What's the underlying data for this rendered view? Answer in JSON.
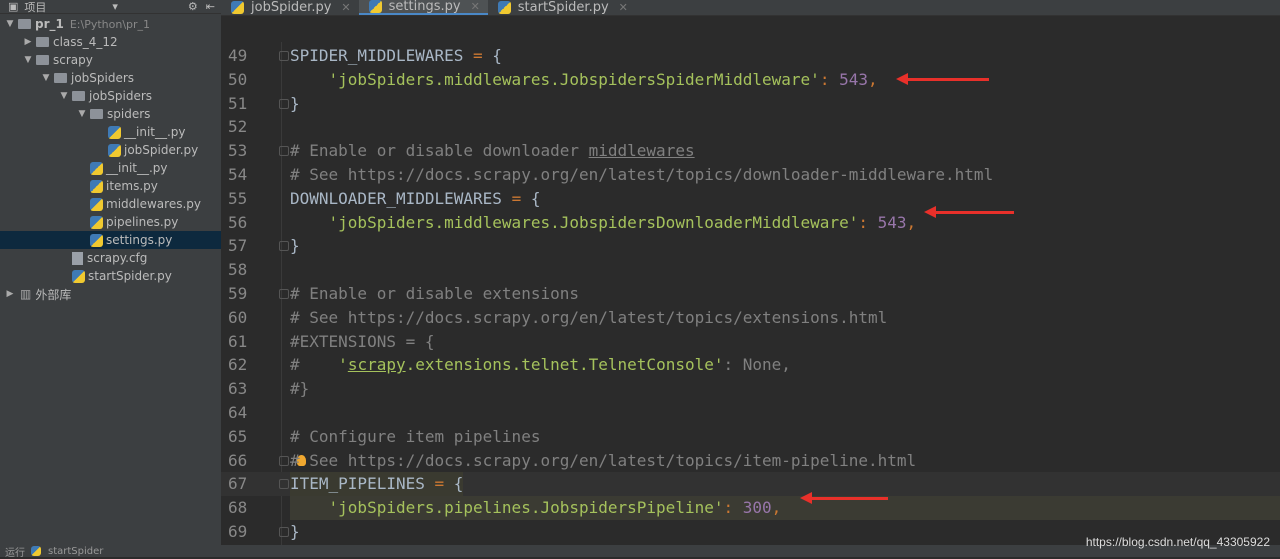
{
  "sidebar": {
    "title": "项目",
    "tree": [
      {
        "label": "pr_1",
        "path": "E:\\Python\\pr_1",
        "type": "folder",
        "depth": 0,
        "open": true
      },
      {
        "label": "class_4_12",
        "type": "folder",
        "depth": 1,
        "open": false
      },
      {
        "label": "scrapy",
        "type": "folder",
        "depth": 1,
        "open": true
      },
      {
        "label": "jobSpiders",
        "type": "folder",
        "depth": 2,
        "open": true
      },
      {
        "label": "jobSpiders",
        "type": "folder",
        "depth": 3,
        "open": true
      },
      {
        "label": "spiders",
        "type": "folder",
        "depth": 4,
        "open": true
      },
      {
        "label": "__init__.py",
        "type": "py",
        "depth": 5
      },
      {
        "label": "jobSpider.py",
        "type": "py",
        "depth": 5
      },
      {
        "label": "__init__.py",
        "type": "py",
        "depth": 4
      },
      {
        "label": "items.py",
        "type": "py",
        "depth": 4
      },
      {
        "label": "middlewares.py",
        "type": "py",
        "depth": 4
      },
      {
        "label": "pipelines.py",
        "type": "py",
        "depth": 4
      },
      {
        "label": "settings.py",
        "type": "py",
        "depth": 4,
        "selected": true
      },
      {
        "label": "scrapy.cfg",
        "type": "cfg",
        "depth": 3
      },
      {
        "label": "startSpider.py",
        "type": "py",
        "depth": 3
      },
      {
        "label": "外部库",
        "type": "lib",
        "depth": 0,
        "open": false
      }
    ]
  },
  "tabs": [
    {
      "label": "jobSpider.py"
    },
    {
      "label": "settings.py",
      "active": true
    },
    {
      "label": "startSpider.py"
    }
  ],
  "lines": [
    {
      "n": "49",
      "html": "SPIDER_MIDDLEWARES <span class='op'>=</span> {",
      "fold": true
    },
    {
      "n": "50",
      "html": "    <span class='st'>'jobSpiders.middlewares.JobspidersSpiderMiddleware'</span><span class='op'>:</span> <span class='nm'>543</span><span class='op'>,</span>"
    },
    {
      "n": "51",
      "html": "}",
      "fold": true
    },
    {
      "n": "52",
      "html": ""
    },
    {
      "n": "53",
      "html": "<span class='cm'># Enable or disable downloader <u>middlewares</u></span>",
      "fold": true
    },
    {
      "n": "54",
      "html": "<span class='cm'># See https://docs.scrapy.org/en/latest/topics/downloader-middleware.html</span>"
    },
    {
      "n": "55",
      "html": "DOWNLOADER_MIDDLEWARES <span class='op'>=</span> {"
    },
    {
      "n": "56",
      "html": "    <span class='st'>'jobSpiders.middlewares.JobspidersDownloaderMiddleware'</span><span class='op'>:</span> <span class='nm'>543</span><span class='op'>,</span>"
    },
    {
      "n": "57",
      "html": "}",
      "fold": true
    },
    {
      "n": "58",
      "html": ""
    },
    {
      "n": "59",
      "html": "<span class='cm'># Enable or disable extensions</span>",
      "fold": true
    },
    {
      "n": "60",
      "html": "<span class='cm'># See https://docs.scrapy.org/en/latest/topics/extensions.html</span>"
    },
    {
      "n": "61",
      "html": "<span class='cm'>#EXTENSIONS = {</span>"
    },
    {
      "n": "62",
      "html": "<span class='cm'>#    <span class='st'>'<u>scrapy</u>.extensions.telnet.TelnetConsole'</span>: None,</span>"
    },
    {
      "n": "63",
      "html": "<span class='cm'>#}</span>"
    },
    {
      "n": "64",
      "html": ""
    },
    {
      "n": "65",
      "html": "<span class='cm'># Configure item pipelines</span>"
    },
    {
      "n": "66",
      "html": "<span class='cm'># See https://docs.scrapy.org/en/latest/topics/item-pipeline.html</span>",
      "fold": true,
      "bulb": true
    },
    {
      "n": "67",
      "html": "ITEM_PIPELINES <span class='op'>=</span> {",
      "fold": true,
      "cur": true
    },
    {
      "n": "68",
      "html": "    <span class='st'>'jobSpiders.pipelines.JobspidersPipeline'</span><span class='op'>:</span> <span class='nm'>300</span><span class='op'>,</span>",
      "hl": true
    },
    {
      "n": "69",
      "html": "}",
      "fold": true
    }
  ],
  "status": {
    "run_label": "运行",
    "config": "startSpider"
  },
  "watermark": "https://blog.csdn.net/qq_43305922"
}
